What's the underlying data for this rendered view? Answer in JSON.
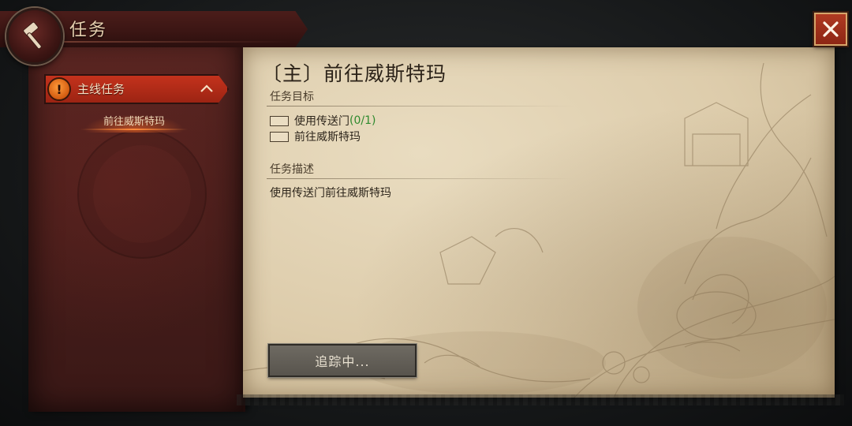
{
  "window": {
    "title": "任务",
    "close_icon": "close-icon"
  },
  "sidebar": {
    "category": {
      "label": "主线任务",
      "badge": "!",
      "expanded": true
    },
    "items": [
      {
        "label": "前往威斯特玛",
        "selected": true
      }
    ]
  },
  "quest": {
    "title": "〔主〕前往威斯特玛",
    "objectives_heading": "任务目标",
    "objectives": [
      {
        "text": "使用传送门",
        "progress": "(0/1)"
      },
      {
        "text": "前往威斯特玛",
        "progress": ""
      }
    ],
    "description_heading": "任务描述",
    "description": "使用传送门前往威斯特玛",
    "track_button_label": "追踪中..."
  },
  "colors": {
    "accent_red": "#b8301a",
    "progress_green": "#2e8a2e",
    "parchment": "#ddccab"
  }
}
